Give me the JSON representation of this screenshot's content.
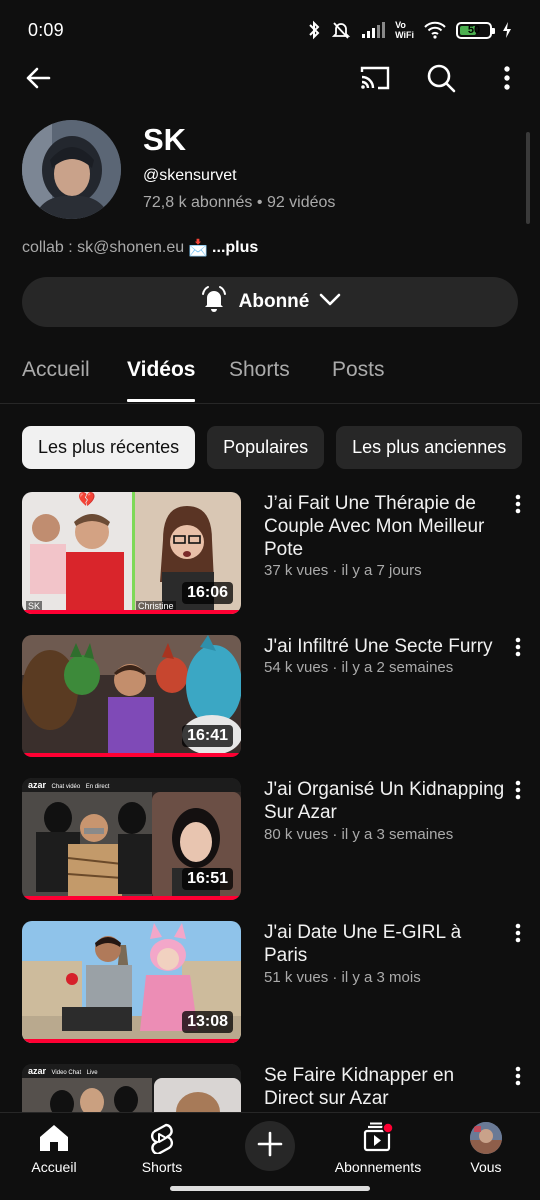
{
  "status_bar": {
    "time": "0:09",
    "vowifi_top": "Vo",
    "vowifi_bottom": "WiFi",
    "battery": "50"
  },
  "top_bar": {
    "back_icon": "arrow-left-icon",
    "cast_icon": "cast-icon",
    "search_icon": "search-icon",
    "menu_icon": "more-vertical-icon"
  },
  "channel": {
    "name": "SK",
    "handle": "@skensurvet",
    "subscribers": "72,8 k abonnés",
    "separator": "•",
    "video_count": "92 vidéos",
    "description": "collab : sk@shonen.eu",
    "description_emoji": "📩",
    "more": "...plus"
  },
  "subscribe": {
    "label": "Abonné",
    "bell_icon": "bell-icon",
    "chevron_icon": "chevron-down-icon"
  },
  "tabs": [
    {
      "label": "Accueil",
      "active": false
    },
    {
      "label": "Vidéos",
      "active": true
    },
    {
      "label": "Shorts",
      "active": false
    },
    {
      "label": "Posts",
      "active": false
    }
  ],
  "chips": [
    {
      "label": "Les plus récentes",
      "active": true
    },
    {
      "label": "Populaires",
      "active": false
    },
    {
      "label": "Les plus anciennes",
      "active": false
    }
  ],
  "videos": [
    {
      "title": "J’ai Fait Une Thérapie de Couple Avec Mon Meilleur Pote",
      "meta": "37 k vues · il y a 7 jours",
      "duration": "16:06",
      "thumb_labels": [
        "SK",
        "Christine"
      ]
    },
    {
      "title": "J'ai Infiltré Une Secte Furry",
      "meta": "54 k vues · il y a 2 semaines",
      "duration": "16:41"
    },
    {
      "title": "J'ai Organisé Un Kidnapping Sur Azar",
      "meta": "80 k vues · il y a 3 semaines",
      "duration": "16:51",
      "thumb_labels": [
        "azar",
        "Chat vidéo",
        "En direct"
      ]
    },
    {
      "title": "J'ai Date Une E-GIRL à Paris",
      "meta": "51 k vues · il y a 3 mois",
      "duration": "13:08"
    },
    {
      "title": "Se Faire Kidnapper en Direct sur Azar",
      "meta": "",
      "duration": "",
      "thumb_labels": [
        "azar",
        "Video Chat",
        "Live"
      ]
    }
  ],
  "bottom_nav": [
    {
      "label": "Accueil",
      "icon": "home-icon"
    },
    {
      "label": "Shorts",
      "icon": "shorts-icon"
    },
    {
      "label": "",
      "icon": "plus-icon"
    },
    {
      "label": "Abonnements",
      "icon": "subscriptions-icon"
    },
    {
      "label": "Vous",
      "icon": "avatar"
    }
  ],
  "colors": {
    "background": "#0f0f0f",
    "chip": "#272727",
    "accent": "#ff0033",
    "secondary_text": "#aaaaaa"
  }
}
